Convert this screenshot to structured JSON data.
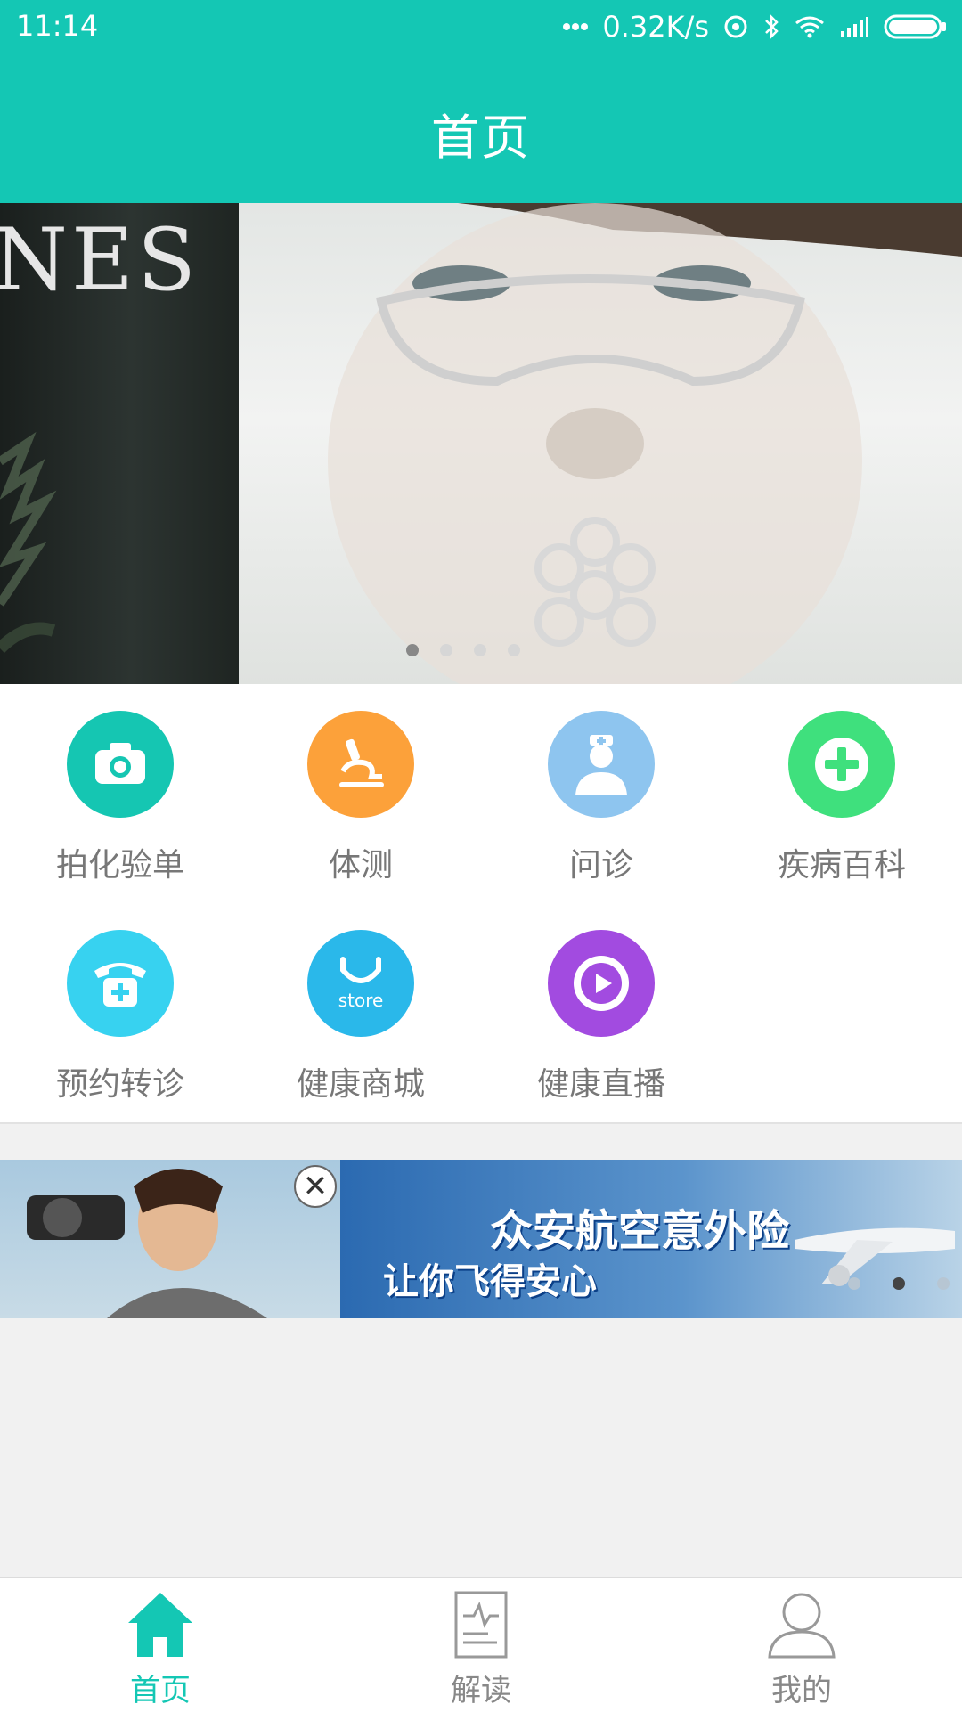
{
  "status_bar": {
    "time": "11:14",
    "speed": "0.32K/s",
    "icons": [
      "dots-icon",
      "hotspot-icon",
      "bluetooth-icon",
      "wifi-icon",
      "signal-icon",
      "battery-icon"
    ]
  },
  "header": {
    "title": "首页"
  },
  "banner": {
    "left_text": "NES",
    "dots_count": 4,
    "active_dot": 1
  },
  "grid": {
    "items": [
      {
        "label": "拍化验单",
        "icon": "camera-icon",
        "color": "#15c6b2"
      },
      {
        "label": "体测",
        "icon": "microscope-icon",
        "color": "#fca13a"
      },
      {
        "label": "问诊",
        "icon": "doctor-icon",
        "color": "#8ec5ef"
      },
      {
        "label": "疾病百科",
        "icon": "plus-icon",
        "color": "#3fe07d"
      },
      {
        "label": "预约转诊",
        "icon": "phone-icon",
        "color": "#37d2f0"
      },
      {
        "label": "健康商城",
        "icon": "store-icon",
        "color": "#2ab8ea"
      },
      {
        "label": "健康直播",
        "icon": "play-icon",
        "color": "#a24be0"
      }
    ],
    "store_text": "store"
  },
  "ad": {
    "line1": "众安航空意外险",
    "line2": "让你飞得安心",
    "close_label": "✕",
    "dots_count": 3,
    "active_dot": 1
  },
  "bottom_nav": {
    "items": [
      {
        "label": "首页",
        "icon": "home-icon",
        "active": true
      },
      {
        "label": "解读",
        "icon": "report-icon",
        "active": false
      },
      {
        "label": "我的",
        "icon": "user-icon",
        "active": false
      }
    ]
  },
  "colors": {
    "primary": "#14c7b4",
    "label_gray": "#777777",
    "background": "#f1f1f1"
  }
}
